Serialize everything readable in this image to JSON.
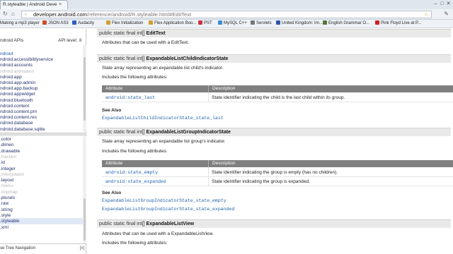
{
  "browser": {
    "tab_title": "R.styleable | Android Deve",
    "tab_close": "×",
    "url_host": "developer.android.com",
    "url_path": "/reference/android/R.styleable.html#EditText",
    "bookmarks": [
      {
        "label": "Making a mp3 player",
        "color": "#4a7bd0"
      },
      {
        "label": "JSON AS3",
        "color": "#d24a2a"
      },
      {
        "label": "Audacity",
        "color": "#2a5fc4"
      },
      {
        "label": "Flex Initialization",
        "color": "#d0a030"
      },
      {
        "label": "Flex Application Boo...",
        "color": "#d0a030"
      },
      {
        "label": "PST",
        "color": "#cc3344"
      },
      {
        "label": "MySQL C++",
        "color": "#3a8fd0"
      },
      {
        "label": "Servlets",
        "color": "#777777"
      },
      {
        "label": "United Kingdom: Im...",
        "color": "#3355aa"
      },
      {
        "label": "English Grammar O...",
        "color": "#557733"
      },
      {
        "label": "Pink Floyd Live at P...",
        "color": "#cc2222"
      }
    ]
  },
  "leftnav": {
    "header_apis": "ndroid APIs",
    "header_level": "API level:",
    "header_level_value": "8",
    "packages": [
      {
        "label": "ndroid",
        "state": "sel"
      },
      {
        "label": "ndroid.accessibilityservice",
        "state": ""
      },
      {
        "label": "ndroid.accounts",
        "state": ""
      },
      {
        "label": "ndroid.animation",
        "state": "dim"
      },
      {
        "label": "ndroid.app",
        "state": ""
      },
      {
        "label": "ndroid.app.admin",
        "state": ""
      },
      {
        "label": "ndroid.app.backup",
        "state": ""
      },
      {
        "label": "ndroid.appwidget",
        "state": ""
      },
      {
        "label": "ndroid.bluetooth",
        "state": ""
      },
      {
        "label": "ndroid.content",
        "state": ""
      },
      {
        "label": "ndroid.content.pm",
        "state": ""
      },
      {
        "label": "ndroid.content.res",
        "state": ""
      },
      {
        "label": "ndroid.database",
        "state": ""
      },
      {
        "label": "ndroid.database.sqlite",
        "state": ""
      }
    ],
    "classes": [
      {
        "label": ".color",
        "state": ""
      },
      {
        "label": ".dimen",
        "state": ""
      },
      {
        "label": ".drawable",
        "state": ""
      },
      {
        "label": ".fraction",
        "state": "dim"
      },
      {
        "label": ".id",
        "state": ""
      },
      {
        "label": ".integer",
        "state": ""
      },
      {
        "label": ".interpolator",
        "state": "dim"
      },
      {
        "label": ".layout",
        "state": ""
      },
      {
        "label": ".menu",
        "state": "dim"
      },
      {
        "label": ".mipmap",
        "state": "dim"
      },
      {
        "label": ".plurals",
        "state": ""
      },
      {
        "label": ".raw",
        "state": ""
      },
      {
        "label": ".string",
        "state": ""
      },
      {
        "label": ".style",
        "state": ""
      },
      {
        "label": ".styleable",
        "state": "lit"
      },
      {
        "label": ".xml",
        "state": ""
      }
    ],
    "footer": "se Tree Navigation",
    "footer_close": "[x]"
  },
  "content": {
    "sections": [
      {
        "sig_prefix": "public static final int[]",
        "sig_name": "EditText",
        "desc": "Attributes that can be used with a EditText."
      },
      {
        "sig_prefix": "public static final int[]",
        "sig_name": "ExpandableListChildIndicatorState",
        "desc": "State array representing an expandable list child's indicator.",
        "includes": "Includes the following attributes:",
        "col_attr": "Attribute",
        "col_desc": "Description",
        "rows": [
          {
            "attr": "android:state_last",
            "desc": "State identifier indicating the child is the last child within its group."
          }
        ],
        "see_also": "See Also",
        "links": [
          "ExpandableListChildIndicatorState_state_last"
        ]
      },
      {
        "sig_prefix": "public static final int[]",
        "sig_name": "ExpandableListGroupIndicatorState",
        "desc": "State array representing an expandable list group's indicator.",
        "includes": "Includes the following attributes:",
        "col_attr": "Attribute",
        "col_desc": "Description",
        "rows": [
          {
            "attr": "android:state_empty",
            "desc": "State identifier indicating the group is empty (has no children)."
          },
          {
            "attr": "android:state_expanded",
            "desc": "State identifier indicating the group is expanded."
          }
        ],
        "see_also": "See Also",
        "links": [
          "ExpandableListGroupIndicatorState_state_empty",
          "ExpandableListGroupIndicatorState_state_expanded"
        ]
      },
      {
        "sig_prefix": "public static final int[]",
        "sig_name": "ExpandableListView",
        "desc": "Attributes that can be used with a ExpandableListView.",
        "includes": "Includes the following attributes:"
      }
    ]
  }
}
